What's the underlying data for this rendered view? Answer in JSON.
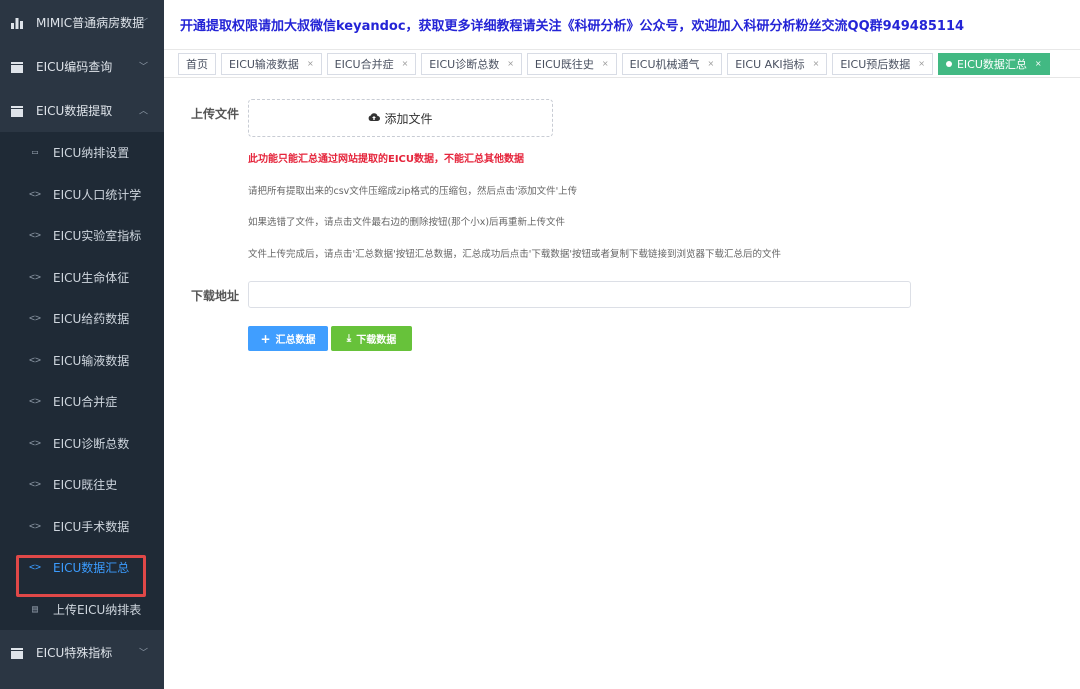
{
  "sidebar": {
    "groups_top": [
      {
        "label": "MIMIC普通病房数据",
        "icon": "bar-chart-icon"
      },
      {
        "label": "EICU编码查询",
        "icon": "folder-icon"
      },
      {
        "label": "EICU数据提取",
        "icon": "folder-icon"
      }
    ],
    "items": [
      {
        "label": "EICU纳排设置",
        "icon": "monitor-icon",
        "glyph": "▭"
      },
      {
        "label": "EICU人口统计学",
        "icon": "code-icon",
        "glyph": "<>"
      },
      {
        "label": "EICU实验室指标",
        "icon": "code-icon",
        "glyph": "<>"
      },
      {
        "label": "EICU生命体征",
        "icon": "code-icon",
        "glyph": "<>"
      },
      {
        "label": "EICU给药数据",
        "icon": "code-icon",
        "glyph": "<>"
      },
      {
        "label": "EICU输液数据",
        "icon": "code-icon",
        "glyph": "<>"
      },
      {
        "label": "EICU合并症",
        "icon": "code-icon",
        "glyph": "<>"
      },
      {
        "label": "EICU诊断总数",
        "icon": "code-icon",
        "glyph": "<>"
      },
      {
        "label": "EICU既往史",
        "icon": "code-icon",
        "glyph": "<>"
      },
      {
        "label": "EICU手术数据",
        "icon": "code-icon",
        "glyph": "<>"
      },
      {
        "label": "EICU数据汇总",
        "icon": "code-icon",
        "glyph": "<>"
      },
      {
        "label": "上传EICU纳排表",
        "icon": "document-icon",
        "glyph": "▤"
      }
    ],
    "group_bottom": {
      "label": "EICU特殊指标",
      "icon": "folder-icon"
    }
  },
  "banner": {
    "text": "开通提取权限请加大叔微信keyandoc，获取更多详细教程请关注《科研分析》公众号，欢迎加入科研分析粉丝交流QQ群949485114"
  },
  "tabs": [
    {
      "label": "首页",
      "closable": false
    },
    {
      "label": "EICU输液数据",
      "closable": true
    },
    {
      "label": "EICU合并症",
      "closable": true
    },
    {
      "label": "EICU诊断总数",
      "closable": true
    },
    {
      "label": "EICU既往史",
      "closable": true
    },
    {
      "label": "EICU机械通气",
      "closable": true
    },
    {
      "label": "EICU AKI指标",
      "closable": true
    },
    {
      "label": "EICU预后数据",
      "closable": true
    },
    {
      "label": "EICU数据汇总",
      "closable": true
    }
  ],
  "tab_close": "×",
  "form": {
    "upload_label": "上传文件",
    "upload_button": "添加文件",
    "warning": "此功能只能汇总通过网站提取的EICU数据，不能汇总其他数据",
    "hints": [
      "请把所有提取出来的csv文件压缩成zip格式的压缩包，然后点击'添加文件'上传",
      "如果选错了文件，请点击文件最右边的删除按钮(那个小x)后再重新上传文件",
      "文件上传完成后，请点击'汇总数据'按钮汇总数据，汇总成功后点击'下载数据'按钮或者复制下载链接到浏览器下载汇总后的文件"
    ],
    "download_label": "下载地址",
    "download_value": "",
    "summarize_button": "汇总数据",
    "download_button": "下载数据"
  },
  "colors": {
    "sidebar_bg": "#2b3643",
    "active_tab": "#42b983",
    "primary": "#409eff",
    "success": "#67c23a",
    "warning_text": "#e5243b",
    "banner_text": "#2424d6"
  }
}
